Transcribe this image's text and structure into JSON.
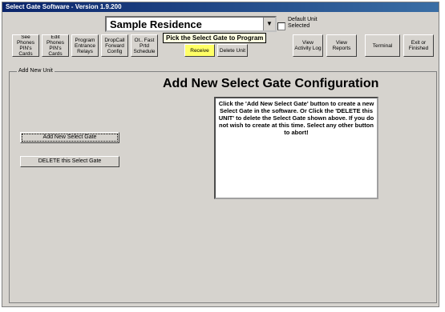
{
  "window": {
    "title": "Select Gate Software - Version 1.9.200"
  },
  "residence_select": {
    "value": "Sample Residence",
    "tooltip": "Pick the Select Gate to Program"
  },
  "default_unit": {
    "label": "Default Unit Selected"
  },
  "toolbar": {
    "buttons": [
      {
        "label": "See Phones PIN's Cards"
      },
      {
        "label": "Edit Phones PIN's Cards"
      },
      {
        "label": "Program Entrance Relays"
      },
      {
        "label": "DropCall Forward Config"
      },
      {
        "label": "Ot.. Fast Prtd Schedule"
      },
      {
        "label": "Receive"
      },
      {
        "label": "Delete Unit"
      },
      {
        "label": "View Activity Log"
      },
      {
        "label": "View Reports"
      },
      {
        "label": "Terminal"
      },
      {
        "label": "Exit or Finished"
      }
    ]
  },
  "section": {
    "legend": "Add New Unit",
    "heading": "Add New Select Gate Configuration",
    "info_text": "Click the 'Add New Select Gate' button to create a new Select Gate in the software. Or Click the 'DELETE this UNIT' to delete the Select Gate shown above. If you do not wish to create at this time. Select any other button to abort!",
    "add_button": "Add New Select Gate",
    "delete_button": "DELETE this Select Gate"
  }
}
